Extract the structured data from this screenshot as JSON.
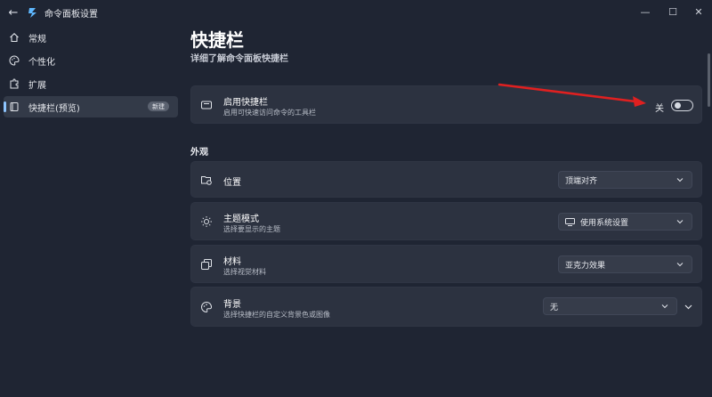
{
  "window": {
    "title": "命令面板设置",
    "minimize_glyph": "—",
    "maximize_glyph": "☐",
    "close_glyph": "✕",
    "back_glyph": "←"
  },
  "sidebar": {
    "items": [
      {
        "label": "常规",
        "icon": "home-icon"
      },
      {
        "label": "个性化",
        "icon": "palette-icon"
      },
      {
        "label": "扩展",
        "icon": "puzzle-icon"
      },
      {
        "label": "快捷栏(预览)",
        "icon": "dock-icon",
        "badge": "新建"
      }
    ]
  },
  "main": {
    "title": "快捷栏",
    "link": "详细了解命令面板快捷栏",
    "enable_card": {
      "title": "启用快捷栏",
      "desc": "启用可快速访问命令的工具栏",
      "toggle_label": "关",
      "toggle_on": false
    },
    "section_appearance": "外观",
    "position_card": {
      "title": "位置",
      "value": "顶端对齐"
    },
    "theme_card": {
      "title": "主题模式",
      "desc": "选择要显示的主题",
      "value": "使用系统设置"
    },
    "material_card": {
      "title": "材料",
      "desc": "选择视觉材料",
      "value": "亚克力效果"
    },
    "background_card": {
      "title": "背景",
      "desc": "选择快捷栏的自定义背景色或图像",
      "value": "无"
    }
  },
  "colors": {
    "background": "#1f2533",
    "card": "#2c3240",
    "accent": "#8ec5ff",
    "annotation_arrow": "#e02020"
  }
}
